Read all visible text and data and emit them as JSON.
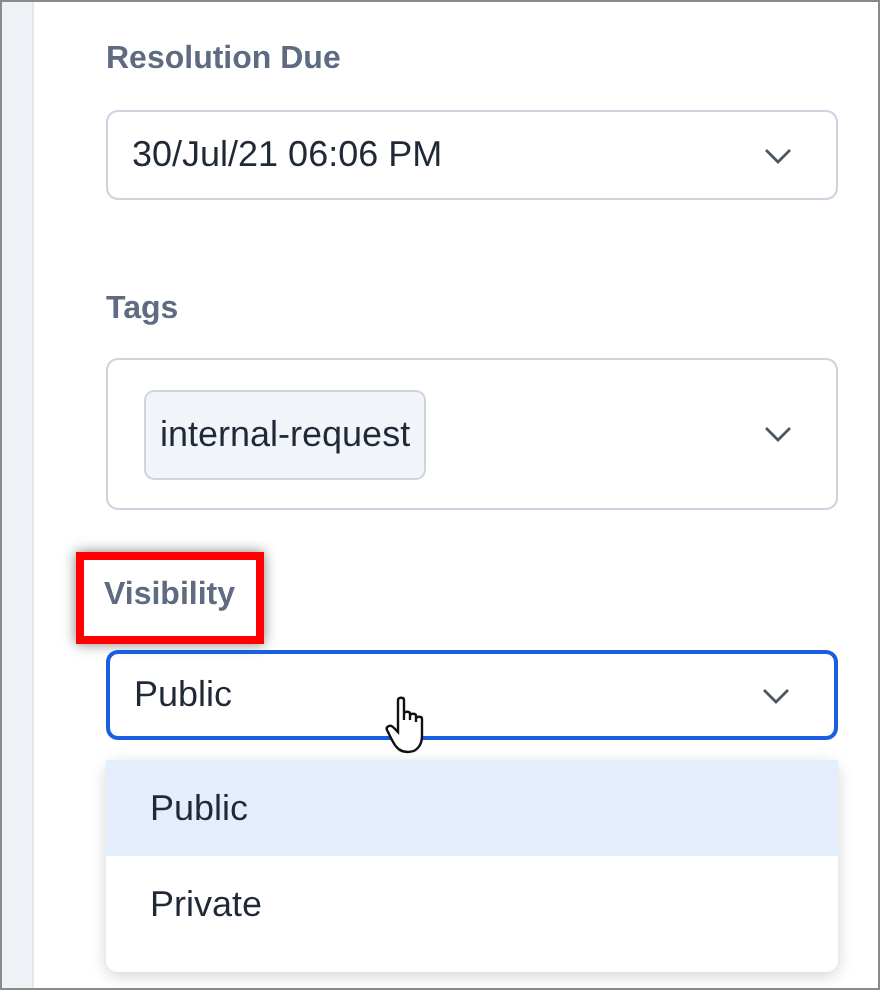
{
  "fields": [
    {
      "kind": "select",
      "label": "Resolution Due",
      "value": "30/Jul/21 06:06 PM",
      "highlighted": false,
      "focused": false
    },
    {
      "kind": "tags",
      "label": "Tags",
      "tags": [
        "internal-request"
      ],
      "highlighted": false,
      "focused": false
    },
    {
      "kind": "select",
      "label": "Visibility",
      "value": "Public",
      "highlighted": true,
      "focused": true,
      "options": [
        {
          "label": "Public",
          "selected": true
        },
        {
          "label": "Private",
          "selected": false
        }
      ]
    }
  ]
}
